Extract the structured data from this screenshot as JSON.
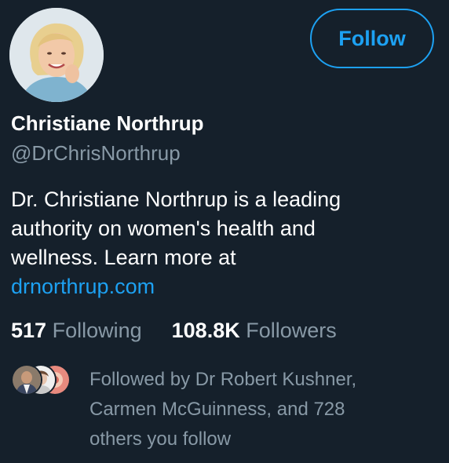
{
  "profile": {
    "name": "Christiane Northrup",
    "handle": "@DrChrisNorthrup",
    "avatar_icon": "profile-photo-icon"
  },
  "follow_button": {
    "label": "Follow"
  },
  "bio": {
    "lines": [
      "Dr. Christiane Northrup is a leading",
      "authority on women's health and",
      "wellness. Learn more at"
    ],
    "link": "drnorthrup.com"
  },
  "stats": {
    "following_count": "517",
    "following_label": "Following",
    "followers_count": "108.8K",
    "followers_label": "Followers"
  },
  "followed_by": {
    "lines": [
      "Followed by Dr Robert Kushner,",
      "Carmen McGuinness, and 728",
      "others you follow"
    ],
    "avatar_icons": [
      "follower-avatar-icon",
      "follower-avatar-icon",
      "follower-avatar-icon"
    ]
  },
  "colors": {
    "background": "#15202b",
    "accent": "#1da1f2",
    "primary_text": "#ffffff",
    "secondary_text": "#8899a6"
  }
}
